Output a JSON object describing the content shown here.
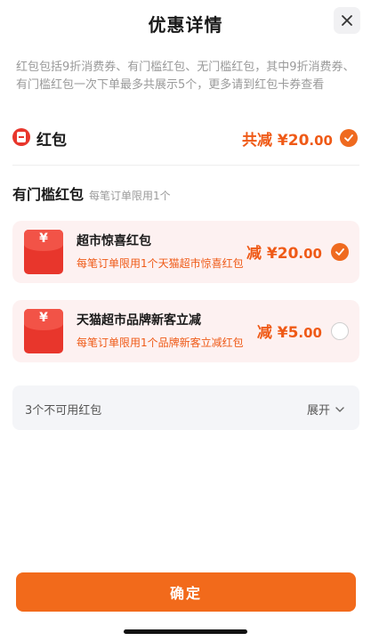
{
  "header": {
    "title": "优惠详情"
  },
  "description": "红包包括9折消费券、有门槛红包、无门槛红包，其中9折消费券、有门槛红包一次下单最多共展示5个，更多请到红包卡券查看",
  "summary": {
    "label": "红包",
    "amount_prefix": "共减 ¥20",
    "amount_decimal": ".00",
    "checked": true
  },
  "section": {
    "title": "有门槛红包",
    "subtitle": "每笔订单限用1个"
  },
  "coupons": [
    {
      "title": "超市惊喜红包",
      "subtitle": "每笔订单限用1个天猫超市惊喜红包",
      "amount_prefix": "减 ¥20",
      "amount_decimal": ".00",
      "checked": true,
      "icon": "yen-red-envelope-icon"
    },
    {
      "title": "天猫超市品牌新客立减",
      "subtitle": "每笔订单限用1个品牌新客立减红包",
      "amount_prefix": "减 ¥5",
      "amount_decimal": ".00",
      "checked": false,
      "icon": "yen-red-envelope-icon"
    }
  ],
  "unusable": {
    "label": "3个不可用红包",
    "expand_label": "展开"
  },
  "footer": {
    "confirm_label": "确定"
  },
  "colors": {
    "accent": "#ef5a17",
    "button": "#f26a1b",
    "card_bg": "#fdf1f1",
    "envelope": "#e8362c"
  }
}
